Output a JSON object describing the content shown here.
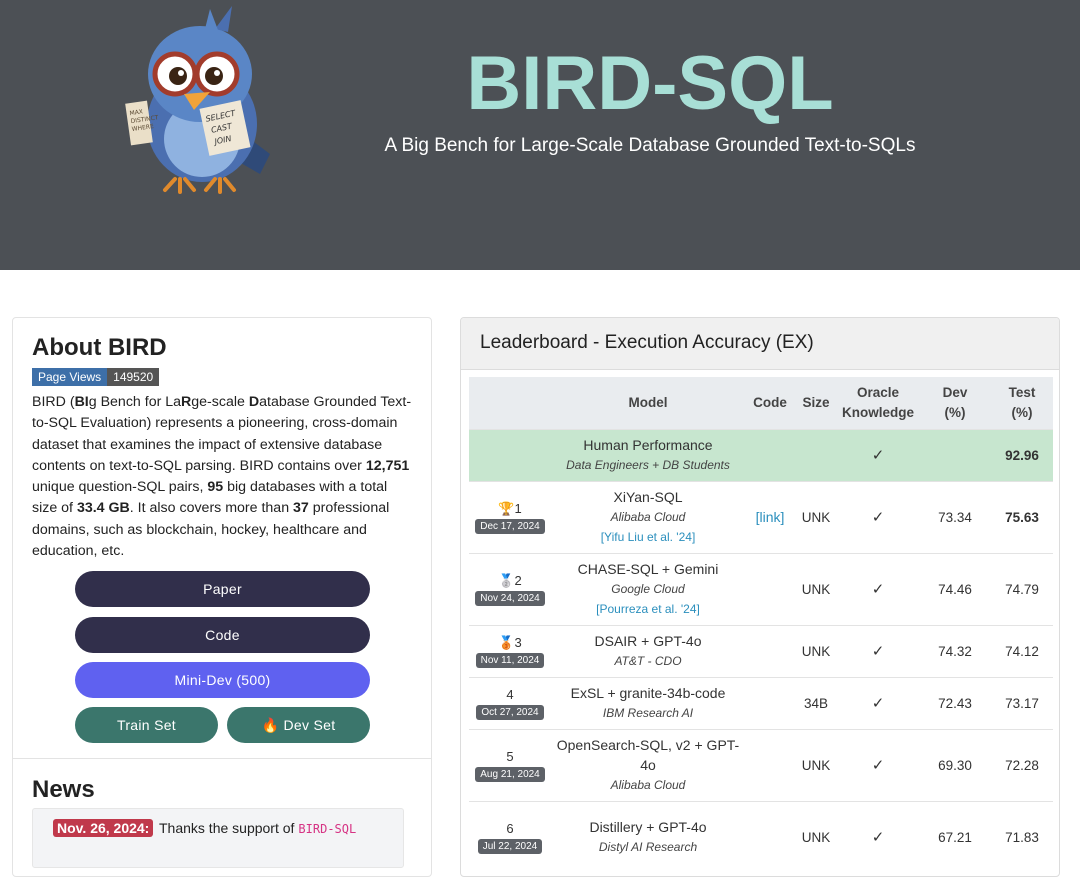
{
  "header": {
    "title": "BIRD-SQL",
    "subtitle": "A Big Bench for Large-Scale Database Grounded Text-to-SQLs",
    "mascot_sign": [
      "SELECT",
      "CAST",
      "JOIN"
    ],
    "mascot_paper": [
      "MAX",
      "DISTINCT",
      "WHERE"
    ]
  },
  "about": {
    "title": "About BIRD",
    "page_views_label": "Page Views",
    "page_views_count": "149520",
    "desc": {
      "p1": "BIRD (",
      "b1": "BI",
      "p2": "g Bench for La",
      "b2": "R",
      "p3": "ge-scale ",
      "b3": "D",
      "p4": "atabase Grounded Text-to-SQL Evaluation) represents a pioneering, cross-domain dataset that examines the impact of extensive database contents on text-to-SQL parsing. BIRD contains over ",
      "b4": "12,751",
      "p5": " unique question-SQL pairs, ",
      "b5": "95",
      "p6": " big databases with a total size of ",
      "b6": "33.4 GB",
      "p7": ". It also covers more than ",
      "b7": "37",
      "p8": " professional domains, such as blockchain, hockey, healthcare and education, etc."
    },
    "buttons": {
      "paper": "Paper",
      "code": "Code",
      "minidev": "Mini-Dev (500)",
      "train": "Train Set",
      "dev": "🔥 Dev Set"
    }
  },
  "news": {
    "title": "News",
    "items": [
      {
        "date": "Nov. 26, 2024:",
        "text": "Thanks the support of",
        "code": "BIRD-SQL"
      }
    ]
  },
  "leaderboard": {
    "title": "Leaderboard - Execution Accuracy (EX)",
    "headers": {
      "model": "Model",
      "code": "Code",
      "size": "Size",
      "oracle1": "Oracle",
      "oracle2": "Knowledge",
      "dev1": "Dev",
      "dev2": "(%)",
      "test1": "Test",
      "test2": "(%)"
    },
    "human": {
      "name": "Human Performance",
      "org": "Data Engineers + DB Students",
      "oracle": "✓",
      "test": "92.96"
    },
    "rows": [
      {
        "rank": "🏆1",
        "date": "Dec 17, 2024",
        "name": "XiYan-SQL",
        "org": "Alibaba Cloud",
        "ref": "[Yifu Liu et al. '24]",
        "code": "[link]",
        "size": "UNK",
        "oracle": "✓",
        "dev": "73.34",
        "test": "75.63"
      },
      {
        "rank": "🥈2",
        "date": "Nov 24, 2024",
        "name": "CHASE-SQL + Gemini",
        "org": "Google Cloud",
        "ref": "[Pourreza et al. '24]",
        "code": "",
        "size": "UNK",
        "oracle": "✓",
        "dev": "74.46",
        "test": "74.79"
      },
      {
        "rank": "🥉3",
        "date": "Nov 11, 2024",
        "name": "DSAIR + GPT-4o",
        "org": "AT&T - CDO",
        "ref": "",
        "code": "",
        "size": "UNK",
        "oracle": "✓",
        "dev": "74.32",
        "test": "74.12"
      },
      {
        "rank": "4",
        "date": "Oct 27, 2024",
        "name": "ExSL + granite-34b-code",
        "org": "IBM Research AI",
        "ref": "",
        "code": "",
        "size": "34B",
        "oracle": "✓",
        "dev": "72.43",
        "test": "73.17"
      },
      {
        "rank": "5",
        "date": "Aug 21, 2024",
        "name": "OpenSearch-SQL, v2 + GPT-4o",
        "org": "Alibaba Cloud",
        "ref": "",
        "code": "",
        "size": "UNK",
        "oracle": "✓",
        "dev": "69.30",
        "test": "72.28"
      },
      {
        "rank": "6",
        "date": "Jul 22, 2024",
        "name": "Distillery + GPT-4o",
        "org": "Distyl AI Research",
        "ref": "",
        "code": "",
        "size": "UNK",
        "oracle": "✓",
        "dev": "67.21",
        "test": "71.83"
      }
    ]
  }
}
